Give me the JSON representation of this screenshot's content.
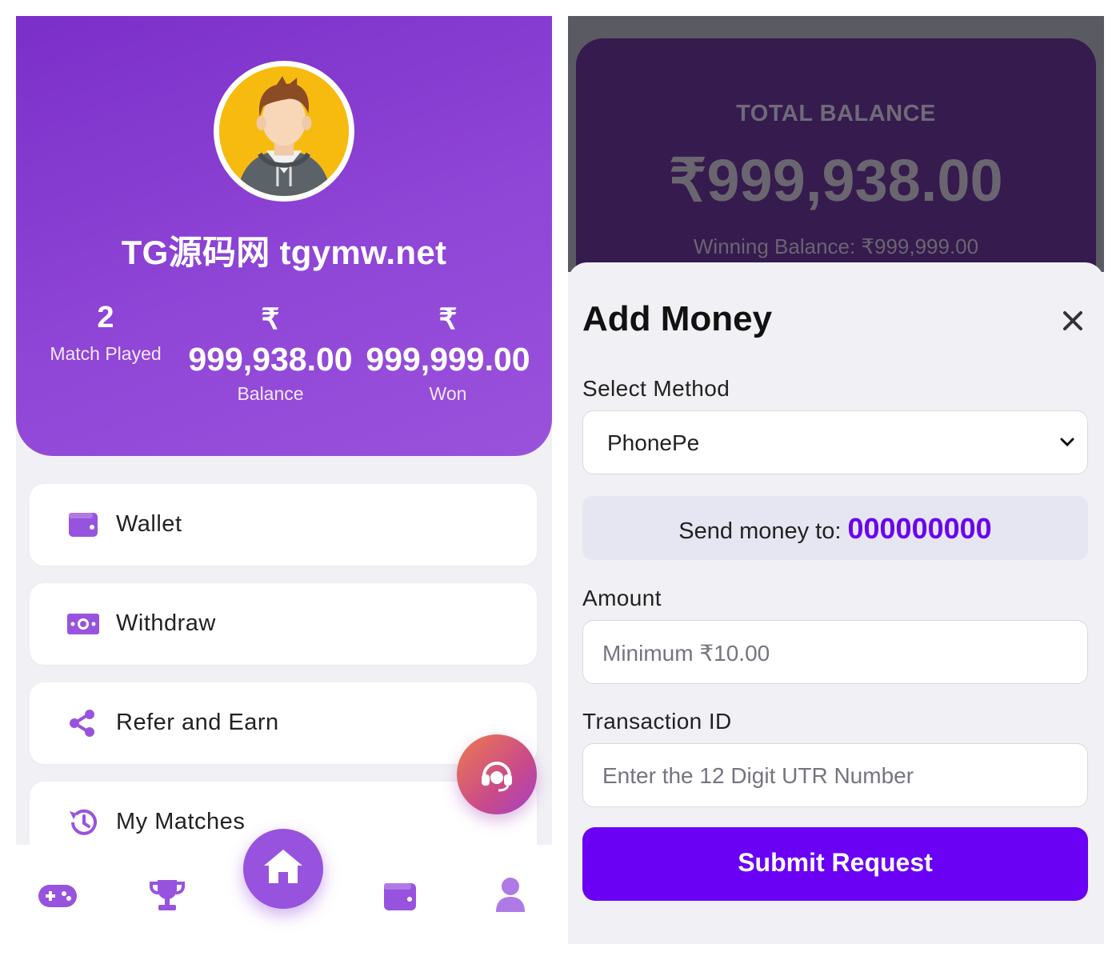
{
  "profile": {
    "username": "TG源码网 tgymw.net",
    "avatar_icon": "user-avatar-icon",
    "stats": {
      "matches": {
        "value": "2",
        "label": "Match Played"
      },
      "balance": {
        "currency": "₹",
        "value": "999,938.00",
        "label": "Balance"
      },
      "won": {
        "currency": "₹",
        "value": "999,999.00",
        "label": "Won"
      }
    }
  },
  "menu": [
    {
      "label": "Wallet",
      "icon": "wallet-icon"
    },
    {
      "label": "Withdraw",
      "icon": "money-bill-icon"
    },
    {
      "label": "Refer and Earn",
      "icon": "share-icon"
    },
    {
      "label": "My Matches",
      "icon": "history-icon"
    }
  ],
  "bottom_nav": [
    {
      "icon": "gamepad-icon"
    },
    {
      "icon": "trophy-icon"
    },
    {
      "icon": "home-icon"
    },
    {
      "icon": "wallet-icon"
    },
    {
      "icon": "user-icon"
    }
  ],
  "support_icon": "headset-icon",
  "wallet_header": {
    "title": "TOTAL BALANCE",
    "amount": "₹999,938.00",
    "winning": "Winning Balance: ₹999,999.00"
  },
  "add_money": {
    "title": "Add Money",
    "close_icon": "close-icon",
    "method_label": "Select Method",
    "method_value": "PhonePe",
    "send_prefix": "Send money to: ",
    "send_number": "000000000",
    "amount_label": "Amount",
    "amount_placeholder": "Minimum ₹10.00",
    "txn_label": "Transaction ID",
    "txn_placeholder": "Enter the 12 Digit UTR Number",
    "submit_label": "Submit Request"
  },
  "colors": {
    "primary_purple": "#8f45d6",
    "accent_violet": "#6a00f4",
    "icon_purple": "#8f45d6"
  }
}
